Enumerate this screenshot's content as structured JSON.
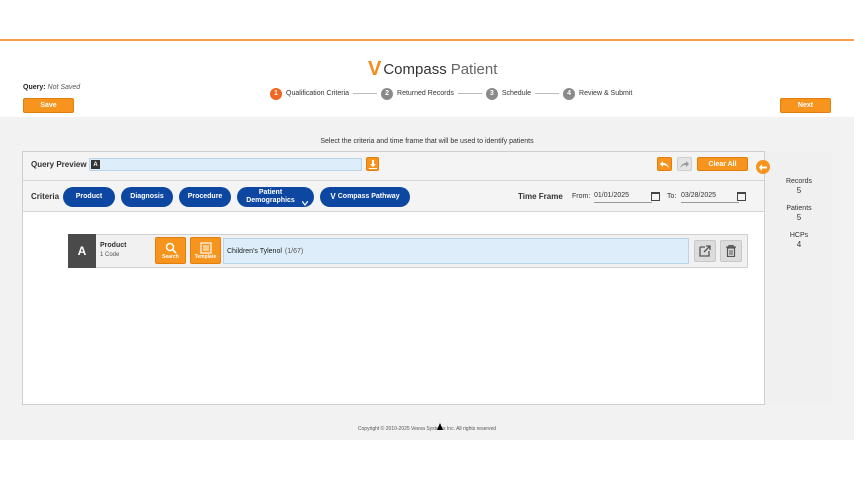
{
  "app": {
    "logo_mark": "V",
    "logo_word1": "Compass",
    "logo_word2": "Patient"
  },
  "query": {
    "label": "Query:",
    "status": "Not Saved"
  },
  "toolbar": {
    "save_label": "Save",
    "next_label": "Next"
  },
  "steps": [
    {
      "num": "1",
      "label": "Qualification Criteria",
      "active": true
    },
    {
      "num": "2",
      "label": "Returned Records",
      "active": false
    },
    {
      "num": "3",
      "label": "Schedule",
      "active": false
    },
    {
      "num": "4",
      "label": "Review & Submit",
      "active": false
    }
  ],
  "instructions": "Select the criteria and time frame that will be used to identify patients",
  "query_preview": {
    "label": "Query Preview",
    "tag": "A",
    "clear_label": "Clear All"
  },
  "criteria": {
    "label": "Criteria",
    "buttons": [
      "Product",
      "Diagnosis",
      "Procedure",
      "Patient Demographics"
    ],
    "pathway_label": "Compass Pathway"
  },
  "time_frame": {
    "label": "Time Frame",
    "from_label": "From:",
    "from_value": "01/01/2025",
    "to_label": "To:",
    "to_value": "03/28/2025"
  },
  "stats": [
    {
      "label": "Records",
      "value": "5"
    },
    {
      "label": "Patients",
      "value": "5"
    },
    {
      "label": "HCPs",
      "value": "4"
    }
  ],
  "criterion": {
    "letter": "A",
    "title": "Product",
    "subtitle": "1 Code",
    "search_label": "Search",
    "template_label": "Template",
    "value": "Children's Tylenol",
    "count": "(1/67)"
  },
  "footer": "Copyright © 2010-2025 Veeva Systems Inc. All rights reserved",
  "colors": {
    "accent": "#f7941d",
    "step_active": "#f26522",
    "pill": "#0d47a1"
  }
}
